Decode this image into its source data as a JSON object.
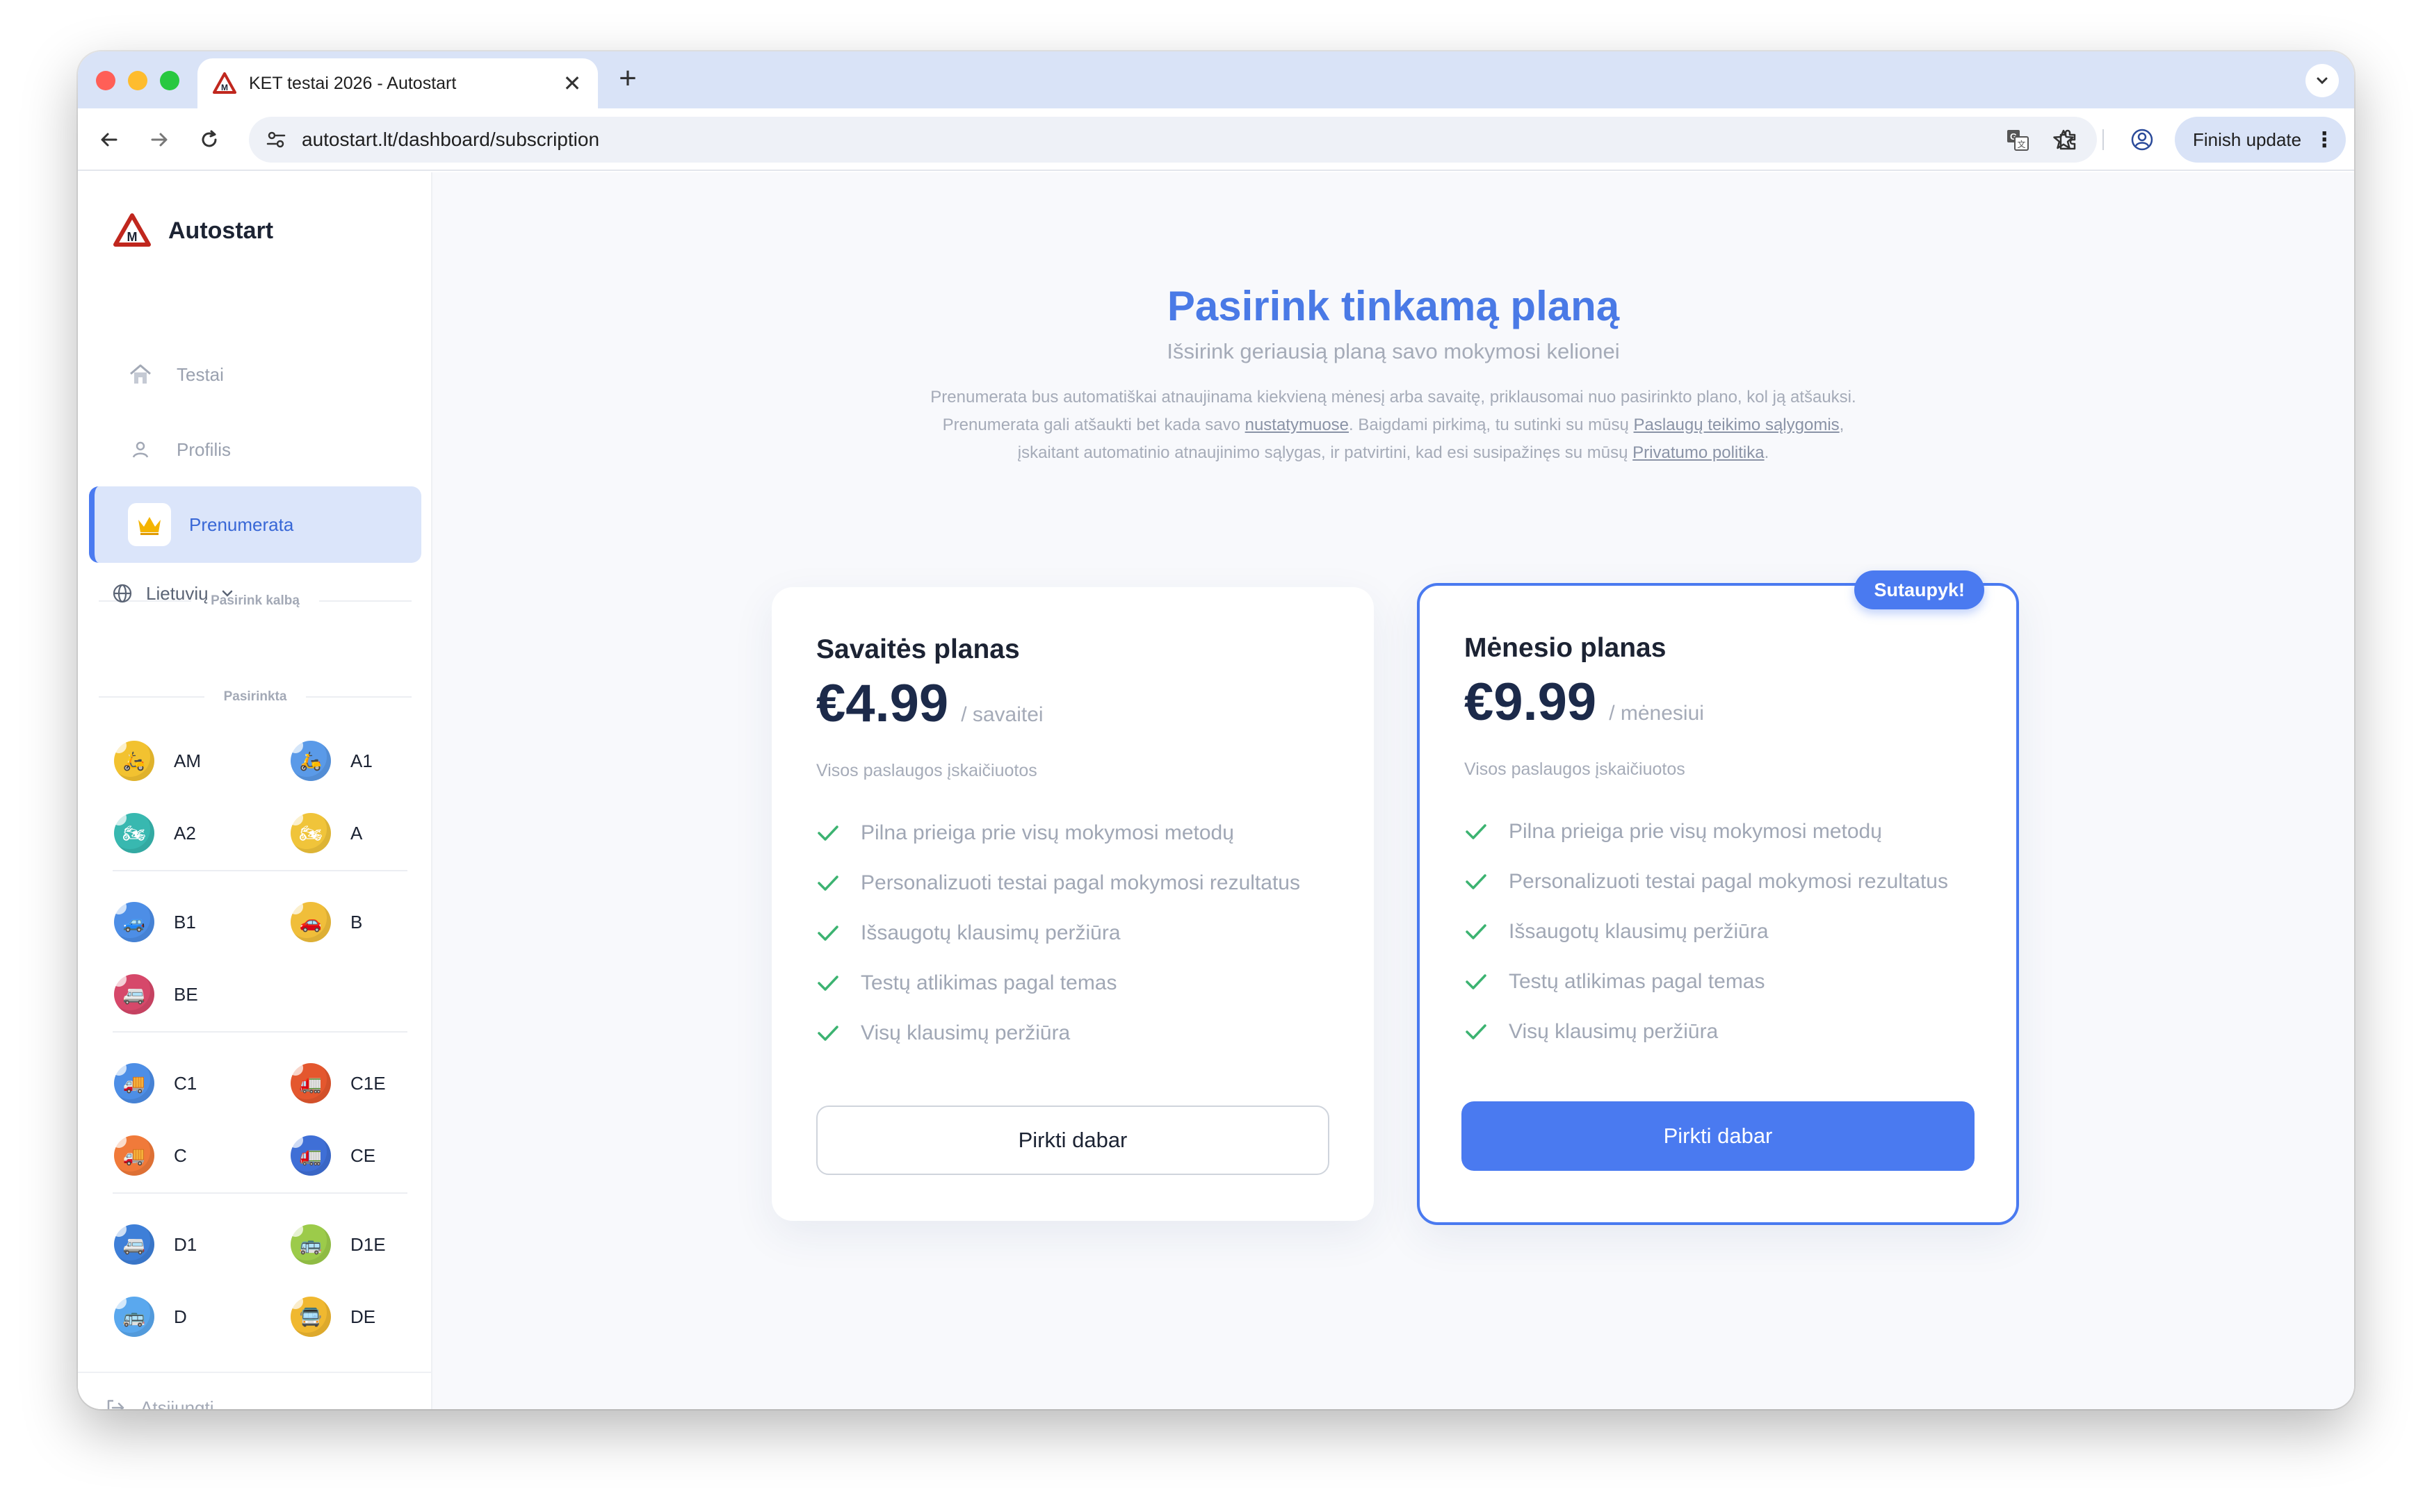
{
  "browser": {
    "tab_title": "KET testai 2026 - Autostart",
    "new_tab_symbol": "+",
    "close_symbol": "✕",
    "url": "autostart.lt/dashboard/subscription",
    "finish_update_label": "Finish update"
  },
  "sidebar": {
    "brand": "Autostart",
    "nav": {
      "tests": "Testai",
      "profile": "Profilis",
      "subscription": "Prenumerata"
    },
    "language_section": "Pasirink kalbą",
    "language_value": "Lietuvių",
    "selected_section": "Pasirinkta",
    "categories": {
      "am": "AM",
      "a1": "A1",
      "a2": "A2",
      "a": "A",
      "b1": "B1",
      "b": "B",
      "be": "BE",
      "c1": "C1",
      "c1e": "C1E",
      "c": "C",
      "ce": "CE",
      "d1": "D1",
      "d1e": "D1E",
      "d": "D",
      "de": "DE"
    },
    "logout": "Atsijungti"
  },
  "main": {
    "title": "Pasirink tinkamą planą",
    "subtitle": "Išsirink geriausią planą savo mokymosi kelionei",
    "note": {
      "line1": "Prenumerata bus automatiškai atnaujinama kiekvieną mėnesį arba savaitę, priklausomai nuo pasirinkto plano, kol ją atšauksi.",
      "line2_a": "Prenumerata gali atšaukti bet kada savo ",
      "line2_link": "nustatymuose",
      "line2_b": ". Baigdami pirkimą, tu sutinki su mūsų ",
      "line2_link2": "Paslaugų teikimo sąlygomis",
      "line2_c": ",",
      "line3_a": "įskaitant automatinio atnaujinimo sąlygas, ir patvirtini, kad esi susipažinęs su mūsų ",
      "line3_link": "Privatumo politika",
      "line3_b": "."
    },
    "plans": [
      {
        "name": "Savaitės planas",
        "price": "€4.99",
        "period": "/ savaitei",
        "included": "Visos paslaugos įskaičiuotos",
        "features": [
          "Pilna prieiga prie visų mokymosi metodų",
          "Personalizuoti testai pagal mokymosi rezultatus",
          "Išsaugotų klausimų peržiūra",
          "Testų atlikimas pagal temas",
          "Visų klausimų peržiūra"
        ],
        "button": "Pirkti dabar"
      },
      {
        "name": "Mėnesio planas",
        "price": "€9.99",
        "period": "/ mėnesiui",
        "included": "Visos paslaugos įskaičiuotos",
        "badge": "Sutaupyk!",
        "features": [
          "Pilna prieiga prie visų mokymosi metodų",
          "Personalizuoti testai pagal mokymosi rezultatus",
          "Išsaugotų klausimų peržiūra",
          "Testų atlikimas pagal temas",
          "Visų klausimų peržiūra"
        ],
        "button": "Pirkti dabar"
      }
    ]
  },
  "colors": {
    "accent": "#4a7af0",
    "title": "#4a7ae6",
    "tabstrip": "#d9e3f7",
    "check": "#3cb371"
  }
}
